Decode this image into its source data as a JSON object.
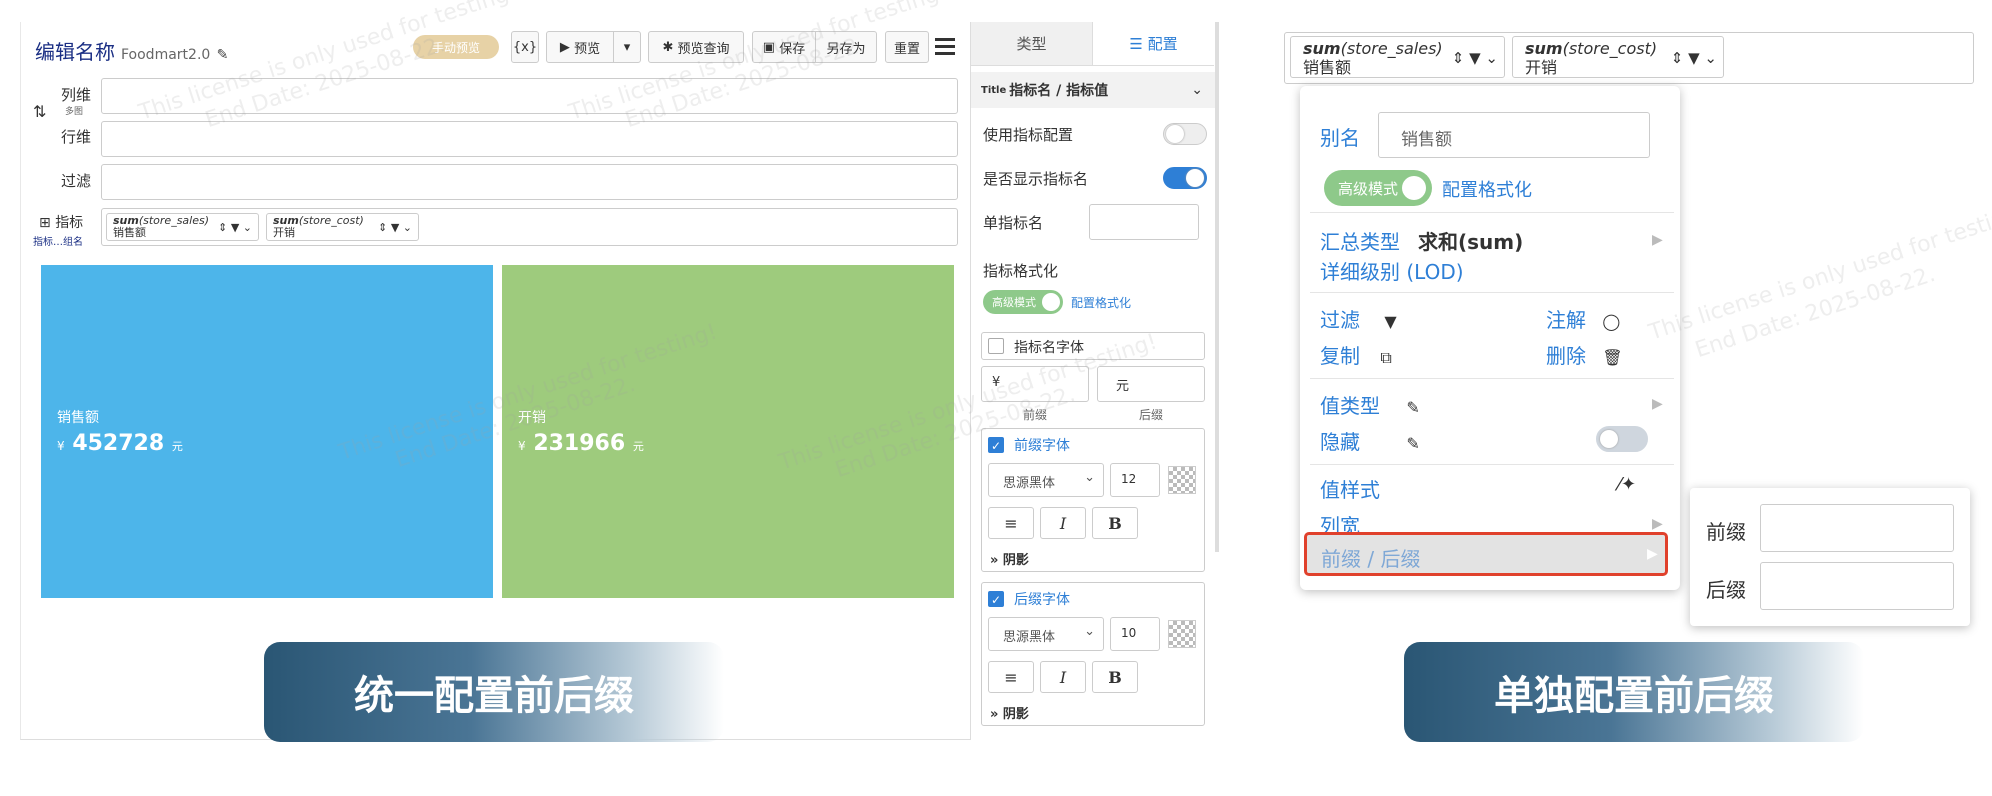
{
  "left_panel": {
    "title": "编辑名称",
    "version": "Foodmart2.0",
    "manual_preview": "手动预览",
    "toolbar": {
      "formula": "{x}",
      "preview": "预览",
      "preview_query": "预览查询",
      "save": "保存",
      "save_as": "另存为",
      "reset": "重置"
    },
    "dims": {
      "columns": "列维",
      "multi_chart": "多图",
      "rows": "行维",
      "filter": "过滤",
      "measures": "指标",
      "measures_group": "指标…组名"
    },
    "measure_chips": [
      {
        "func": "sum",
        "field": "(store_sales)",
        "alias": "销售额"
      },
      {
        "func": "sum",
        "field": "(store_cost)",
        "alias": "开销"
      }
    ],
    "cards": [
      {
        "name": "销售额",
        "prefix": "¥",
        "value": "452728",
        "suffix": "元",
        "color": "#4db5ea"
      },
      {
        "name": "开销",
        "prefix": "¥",
        "value": "231966",
        "suffix": "元",
        "color": "#9ecb7d"
      }
    ]
  },
  "config_panel": {
    "tabs": [
      "类型",
      "配置"
    ],
    "section_title": "指标名 / 指标值",
    "use_measure_config": "使用指标配置",
    "show_measure_name": "是否显示指标名",
    "single_measure_name": "单指标名",
    "measure_format": "指标格式化",
    "advanced_mode": "高级模式",
    "config_format": "配置格式化",
    "measure_name_font": "指标名字体",
    "prefix_value": "¥",
    "suffix_value": "元",
    "prefix_label": "前缀",
    "suffix_label": "后缀",
    "prefix_font": "前缀字体",
    "suffix_font": "后缀字体",
    "font_name": "思源黑体",
    "prefix_font_size": "12",
    "suffix_font_size": "10",
    "italic": "I",
    "bold": "B",
    "shadow": "» 阴影"
  },
  "right_panel": {
    "chips": [
      {
        "func": "sum",
        "field": "(store_sales)",
        "alias": "销售额"
      },
      {
        "func": "sum",
        "field": "(store_cost)",
        "alias": "开销"
      }
    ],
    "menu": {
      "alias_label": "别名",
      "alias_value": "销售额",
      "advanced_mode": "高级模式",
      "config_format": "配置格式化",
      "agg_type": "汇总类型",
      "agg_value": "求和(sum)",
      "lod": "详细级别 (LOD)",
      "filter": "过滤",
      "note": "注解",
      "copy": "复制",
      "delete": "删除",
      "value_type": "值类型",
      "hide": "隐藏",
      "value_style": "值样式",
      "col_width": "列宽",
      "prefix_suffix": "前缀 / 后缀"
    },
    "submenu": {
      "prefix": "前缀",
      "suffix": "后缀"
    }
  },
  "banners": {
    "left": "统一配置前后缀",
    "right": "单独配置前后缀"
  },
  "watermark": {
    "line1": "This license is only used for testing!",
    "line2": "End Date: 2025-08-22."
  },
  "colors": {
    "accent_blue": "#2e7fd6",
    "highlight_red": "#e0412c",
    "card_blue": "#4db5ea",
    "card_green": "#9ecb7d"
  }
}
